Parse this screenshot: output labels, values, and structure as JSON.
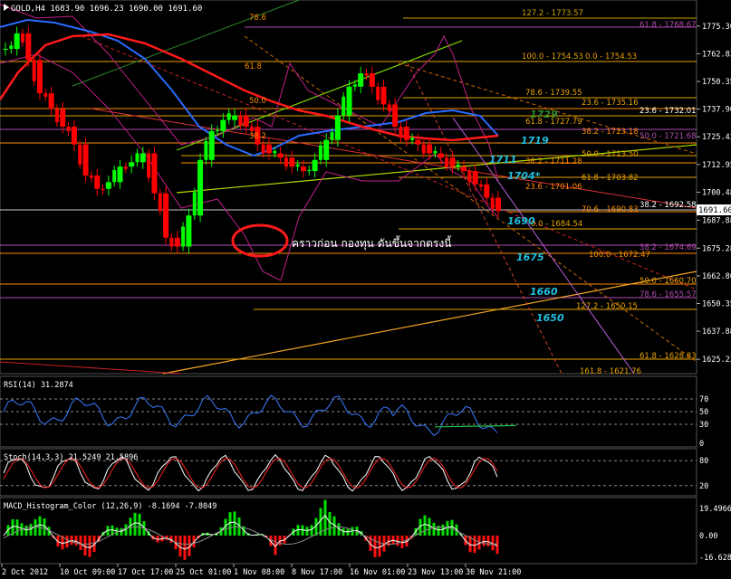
{
  "header": {
    "symbol_line": "GOLD,H4 1683.90 1696.23 1690.00 1691.60"
  },
  "price_axis": {
    "min": 1620,
    "max": 1785,
    "ticks": [
      "1775.30",
      "1762.83",
      "1750.35",
      "1737.90",
      "1725.43",
      "1712.95",
      "1700.48",
      "1687.88",
      "1675.28",
      "1662.80",
      "1650.35",
      "1637.88",
      "1625.23"
    ],
    "current": "1691.60"
  },
  "time_axis": {
    "labels": [
      "2 Oct 2012",
      "10 Oct 09:00",
      "17 Oct 17:00",
      "25 Oct 01:00",
      "1 Nov 08:00",
      "8 Nov 17:00",
      "16 Nov 01:00",
      "23 Nov 13:00",
      "30 Nov 21:00"
    ]
  },
  "fib_labels": {
    "f1": "127.2 - 1773.57",
    "f2": "61.8 - 1768.67",
    "f3": "78.6",
    "f4": "61.8",
    "f5": "100.0 - 1754.53",
    "f6": "0.0 - 1754.53",
    "f7": "50.0",
    "f8": "78.6 - 1739.55",
    "f9": "23.6 - 1735.16",
    "f10": "61.8 - 1727.79",
    "f11": "23.6 - 1732.01",
    "f12": "38.2",
    "f13": "38.2 - 1723.18",
    "f14": "50.0 - 1721.68",
    "f15": "50.0 - 1713.50",
    "f16": "38.2 - 1711.28",
    "f17": "61.8 - 1703.82",
    "f18": "23.6 - 1701.06",
    "f19": "38.2 - 1692.58",
    "f20": "70.6 - 1690.83",
    "f21": "0.0 - 1684.54",
    "f22": "100.0 - 1672.47",
    "f23": "38.2 - 1674.69",
    "f24": "50.0 - 1660.70",
    "f25": "78.6 - 1655.57",
    "f26": "127.2 - 1650.15",
    "f27": "61.8 - 1628.83",
    "f28": "161.8 - 1621.76"
  },
  "level_labels": {
    "l1": "1729",
    "l2": "1719",
    "l3": "1711",
    "l4": "1704*",
    "l5": "1690",
    "l6": "1675",
    "l7": "1660",
    "l8": "1650"
  },
  "annotation": "คราวก่อน กองทุน ดันขึ้นจากตรงนี้",
  "rsi": {
    "title": "RSI(14) 31.2874",
    "ticks": [
      "70",
      "50",
      "30",
      "0"
    ],
    "levels": [
      70,
      50,
      30
    ]
  },
  "stoch": {
    "title": "Stoch(14,3,3) 21.5249 21.5896",
    "ticks": [
      "80",
      "20"
    ],
    "levels": [
      80,
      20
    ]
  },
  "macd": {
    "title": "MACD_Histogram_Color (12,26,9) -8.1694 -7.8049",
    "ticks": [
      "19.4966",
      "0.00",
      "-16.6283"
    ]
  },
  "colors": {
    "background": "#000000",
    "up": "#00ff00",
    "down": "#ff0000",
    "ma_fast": "#2a6aff",
    "ma_slow": "#ff1a1a",
    "fib": "#ff8c00",
    "grid": "#555555"
  },
  "chart_data": {
    "type": "line",
    "title": "GOLD,H4 1683.90 1696.23 1690.00 1691.60",
    "x": [
      "2 Oct 2012",
      "10 Oct 09:00",
      "17 Oct 17:00",
      "25 Oct 01:00",
      "1 Nov 08:00",
      "8 Nov 17:00",
      "16 Nov 01:00",
      "23 Nov 13:00",
      "30 Nov 21:00"
    ],
    "ylim": [
      1620,
      1785
    ],
    "series": [
      {
        "values": [
          1765,
          1772,
          1760,
          1745,
          1738,
          1730,
          1722,
          1708,
          1702,
          1705,
          1712,
          1714,
          1718,
          1700,
          1680,
          1676,
          1690,
          1715,
          1728,
          1733,
          1735,
          1730,
          1722,
          1718,
          1716,
          1712,
          1710,
          1715,
          1724,
          1735,
          1748,
          1754,
          1748,
          1740,
          1730,
          1724,
          1722,
          1718,
          1716,
          1712,
          1710,
          1704,
          1698,
          1692
        ]
      }
    ]
  }
}
